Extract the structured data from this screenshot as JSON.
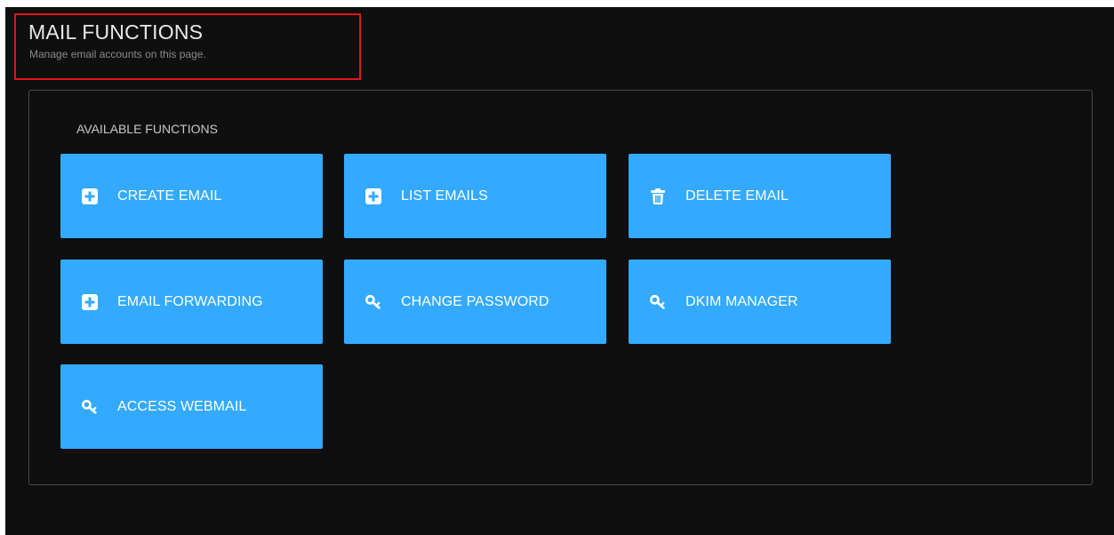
{
  "header": {
    "title": "MAIL FUNCTIONS",
    "subtitle": "Manage email accounts on this page."
  },
  "panel": {
    "heading": "AVAILABLE FUNCTIONS",
    "buttons": [
      {
        "label": "CREATE EMAIL",
        "icon": "plus-square-icon"
      },
      {
        "label": "LIST EMAILS",
        "icon": "plus-square-icon"
      },
      {
        "label": "DELETE EMAIL",
        "icon": "trash-icon"
      },
      {
        "label": "EMAIL FORWARDING",
        "icon": "plus-square-icon"
      },
      {
        "label": "CHANGE PASSWORD",
        "icon": "key-icon"
      },
      {
        "label": "DKIM MANAGER",
        "icon": "key-icon"
      },
      {
        "label": "ACCESS WEBMAIL",
        "icon": "key-icon"
      }
    ]
  },
  "colors": {
    "background": "#0f0f0f",
    "button": "#33aaff",
    "highlight_border": "#e0151b"
  }
}
